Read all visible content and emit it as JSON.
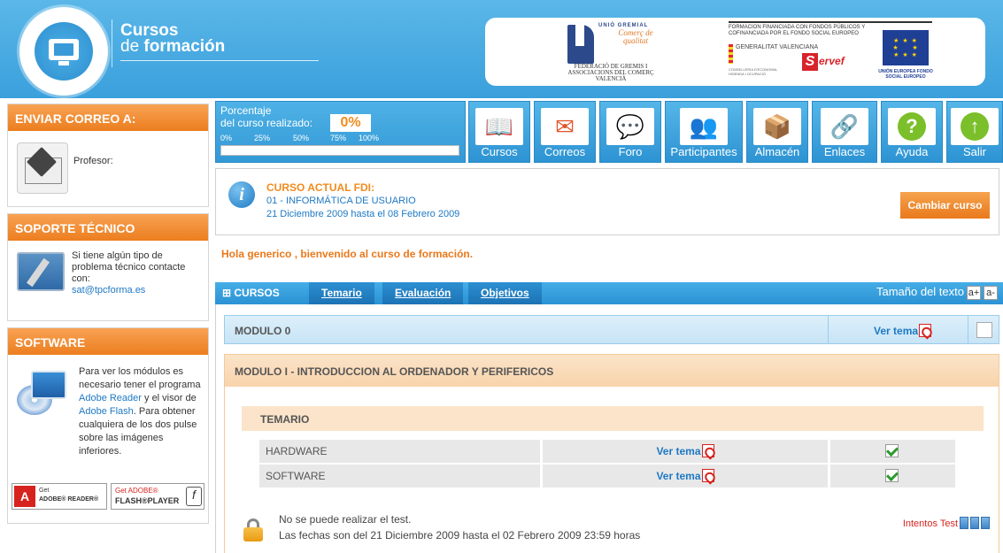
{
  "header": {
    "brand_line1": "Cursos",
    "brand_line2_pre": "de ",
    "brand_line2_bold": "formación",
    "sponsor": {
      "union_label": "UNIÓ GREMIAL",
      "comerc": "Comerç de qualitat",
      "federacio": "FEDERACIÓ DE GREMIS I ASSOCIACIONS DEL COMERÇ VALENCIÀ",
      "financing": "FORMACION FINANCIADA CON FONDOS PÚBLICOS Y COFINANCIADA POR EL FONDO SOCIAL EUROPEO",
      "generalitat": "GENERALITAT VALENCIANA",
      "conselleria": "CONSELLERIA D'ECONOMIA, HISENDA I OCUPACIÓ",
      "servef": "ervef",
      "servef_s": "S",
      "eu": "UNIÓN EUROPEA FONDO SOCIAL EUROPEO"
    }
  },
  "sidebar": {
    "mail": {
      "title": "ENVIAR CORREO A:",
      "label": "Profesor:"
    },
    "support": {
      "title": "SOPORTE TÉCNICO",
      "text": "Si tiene algún tipo de problema técnico contacte con:",
      "email": "sat@tpcforma.es"
    },
    "software": {
      "title": "SOFTWARE",
      "text_a": "Para ver los módulos es necesario tener el programa ",
      "link_reader": "Adobe Reader",
      "text_b": " y el visor de ",
      "link_flash": "Adobe Flash",
      "text_c": ". Para obtener cualquiera de los dos pulse sobre las imágenes inferiores.",
      "reader_get": "Get",
      "reader_name": "ADOBE® READER®",
      "flash_get": "Get ADOBE®",
      "flash_name": "FLASH®PLAYER"
    }
  },
  "progress": {
    "label1": "Porcentaje",
    "label2": "del curso realizado:",
    "percent": "0%",
    "value": 0,
    "ticks": [
      "0%",
      "25%",
      "50%",
      "75%",
      "100%"
    ]
  },
  "toolbar": [
    {
      "label": "Cursos",
      "icon": "book-icon"
    },
    {
      "label": "Correos",
      "icon": "envelope-icon"
    },
    {
      "label": "Foro",
      "icon": "chat-bubbles-icon"
    },
    {
      "label": "Participantes",
      "icon": "people-icon"
    },
    {
      "label": "Almacén",
      "icon": "boxes-icon"
    },
    {
      "label": "Enlaces",
      "icon": "chain-link-icon"
    },
    {
      "label": "Ayuda",
      "icon": "help-icon"
    },
    {
      "label": "Salir",
      "icon": "exit-arrow-icon"
    }
  ],
  "course": {
    "title": "CURSO ACTUAL FDI:",
    "name": "01 - INFORMÁTICA DE USUARIO",
    "dates": "21 Diciembre 2009 hasta el 08 Febrero 2009",
    "change_button": "Cambiar curso"
  },
  "welcome": "Hola generico , bienvenido al curso de formación.",
  "tabs": {
    "main": "⊞ CURSOS",
    "items": [
      "Temario",
      "Evaluación",
      "Objetivos"
    ],
    "text_size_label": "Tamaño del texto",
    "increase": "a+",
    "decrease": "a-"
  },
  "modules": {
    "mod0": {
      "title": "MODULO 0",
      "ver_tema": "Ver tema"
    },
    "mod1": {
      "title": "MODULO I - INTRODUCCION AL ORDENADOR Y PERIFERICOS",
      "temario": "TEMARIO",
      "rows": [
        {
          "name": "HARDWARE",
          "ver_tema": "Ver tema"
        },
        {
          "name": "SOFTWARE",
          "ver_tema": "Ver tema"
        }
      ],
      "lock_msg1": "No se puede realizar el test.",
      "lock_msg2": "Las fechas son del 21 Diciembre 2009 hasta el 02 Febrero 2009 23:59 horas",
      "intentos": "Intentos Test"
    }
  },
  "colors": {
    "accent_orange": "#f08c1e",
    "header_blue": "#3aa0dc",
    "link_blue": "#1e79c4"
  }
}
